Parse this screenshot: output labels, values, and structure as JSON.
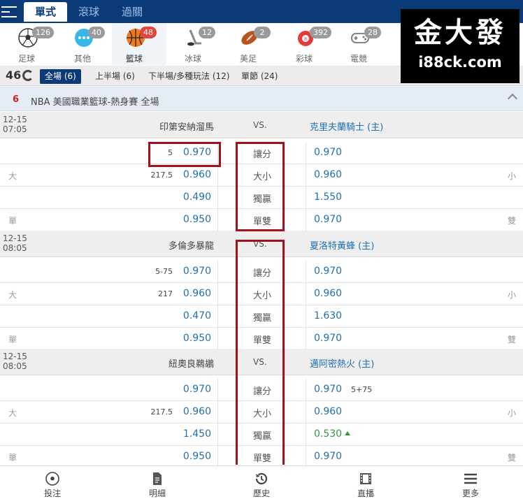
{
  "top_tabs": [
    "單式",
    "滾球",
    "過關"
  ],
  "sports": [
    {
      "label": "足球",
      "count": "126",
      "icon": "soccer-ball-icon"
    },
    {
      "label": "其他",
      "count": "40",
      "icon": "more-dots-icon"
    },
    {
      "label": "籃球",
      "count": "48",
      "icon": "basketball-icon"
    },
    {
      "label": "冰球",
      "count": "12",
      "icon": "hockey-stick-icon"
    },
    {
      "label": "美足",
      "count": "2",
      "icon": "american-football-icon"
    },
    {
      "label": "彩球",
      "count": "392",
      "icon": "lottery-ball-icon"
    },
    {
      "label": "電競",
      "count": "28",
      "icon": "gamepad-icon"
    }
  ],
  "logo": {
    "big": "金大發",
    "small": "i88ck.com"
  },
  "period": {
    "count": "46",
    "tabs": [
      "全場 (6)",
      "上半場 (6)",
      "下半場/多種玩法 (12)",
      "單節 (24)"
    ]
  },
  "league": {
    "num": "6",
    "name": "NBA 美國職業籃球-熱身賽 全場"
  },
  "matches": [
    {
      "date": "12-15",
      "time": "07:05",
      "home": "印第安納溜馬",
      "vs": "VS.",
      "away": "克里夫蘭騎士 (主)",
      "rows": [
        {
          "left": "",
          "line": "5",
          "home_odd": "0.970",
          "bet": "讓分",
          "away_odd": "0.970",
          "away_line": "",
          "right": ""
        },
        {
          "left": "大",
          "line": "217.5",
          "home_odd": "0.960",
          "bet": "大小",
          "away_odd": "0.960",
          "away_line": "",
          "right": "小"
        },
        {
          "left": "",
          "line": "",
          "home_odd": "0.490",
          "bet": "獨贏",
          "away_odd": "1.550",
          "away_line": "",
          "right": ""
        },
        {
          "left": "單",
          "line": "",
          "home_odd": "0.950",
          "bet": "單雙",
          "away_odd": "0.970",
          "away_line": "",
          "right": "雙"
        }
      ]
    },
    {
      "date": "12-15",
      "time": "08:05",
      "home": "多倫多暴龍",
      "vs": "VS.",
      "away": "夏洛特黃蜂 (主)",
      "rows": [
        {
          "left": "",
          "line": "5-75",
          "home_odd": "0.970",
          "bet": "讓分",
          "away_odd": "0.970",
          "away_line": "",
          "right": ""
        },
        {
          "left": "大",
          "line": "217",
          "home_odd": "0.960",
          "bet": "大小",
          "away_odd": "0.960",
          "away_line": "",
          "right": "小"
        },
        {
          "left": "",
          "line": "",
          "home_odd": "0.470",
          "bet": "獨贏",
          "away_odd": "1.630",
          "away_line": "",
          "right": ""
        },
        {
          "left": "單",
          "line": "",
          "home_odd": "0.950",
          "bet": "單雙",
          "away_odd": "0.970",
          "away_line": "",
          "right": "雙"
        }
      ]
    },
    {
      "date": "12-15",
      "time": "08:05",
      "home": "紐奧良鵜鶘",
      "vs": "VS.",
      "away": "邁阿密熱火 (主)",
      "rows": [
        {
          "left": "",
          "line": "",
          "home_odd": "0.970",
          "bet": "讓分",
          "away_odd": "0.970",
          "away_line": "5+75",
          "right": ""
        },
        {
          "left": "大",
          "line": "217.5",
          "home_odd": "0.960",
          "bet": "大小",
          "away_odd": "0.960",
          "away_line": "",
          "right": "小"
        },
        {
          "left": "",
          "line": "",
          "home_odd": "1.450",
          "bet": "獨贏",
          "away_odd": "0.530",
          "away_line": "",
          "right": ""
        },
        {
          "left": "單",
          "line": "",
          "home_odd": "0.950",
          "bet": "單雙",
          "away_odd": "0.970",
          "away_line": "",
          "right": "雙"
        }
      ]
    }
  ],
  "bottom_nav": [
    {
      "label": "投注",
      "icon": "soccer-ball-icon"
    },
    {
      "label": "明細",
      "icon": "document-icon"
    },
    {
      "label": "歷史",
      "icon": "history-icon"
    },
    {
      "label": "直播",
      "icon": "film-icon"
    },
    {
      "label": "更多",
      "icon": "menu-icon"
    }
  ],
  "colors": {
    "nav_blue": "#0b3a78",
    "odds_blue": "#1f6fb2",
    "odds_up_green": "#2e9a3a",
    "league_red": "#d02020",
    "highlight_red": "#a3121c"
  }
}
